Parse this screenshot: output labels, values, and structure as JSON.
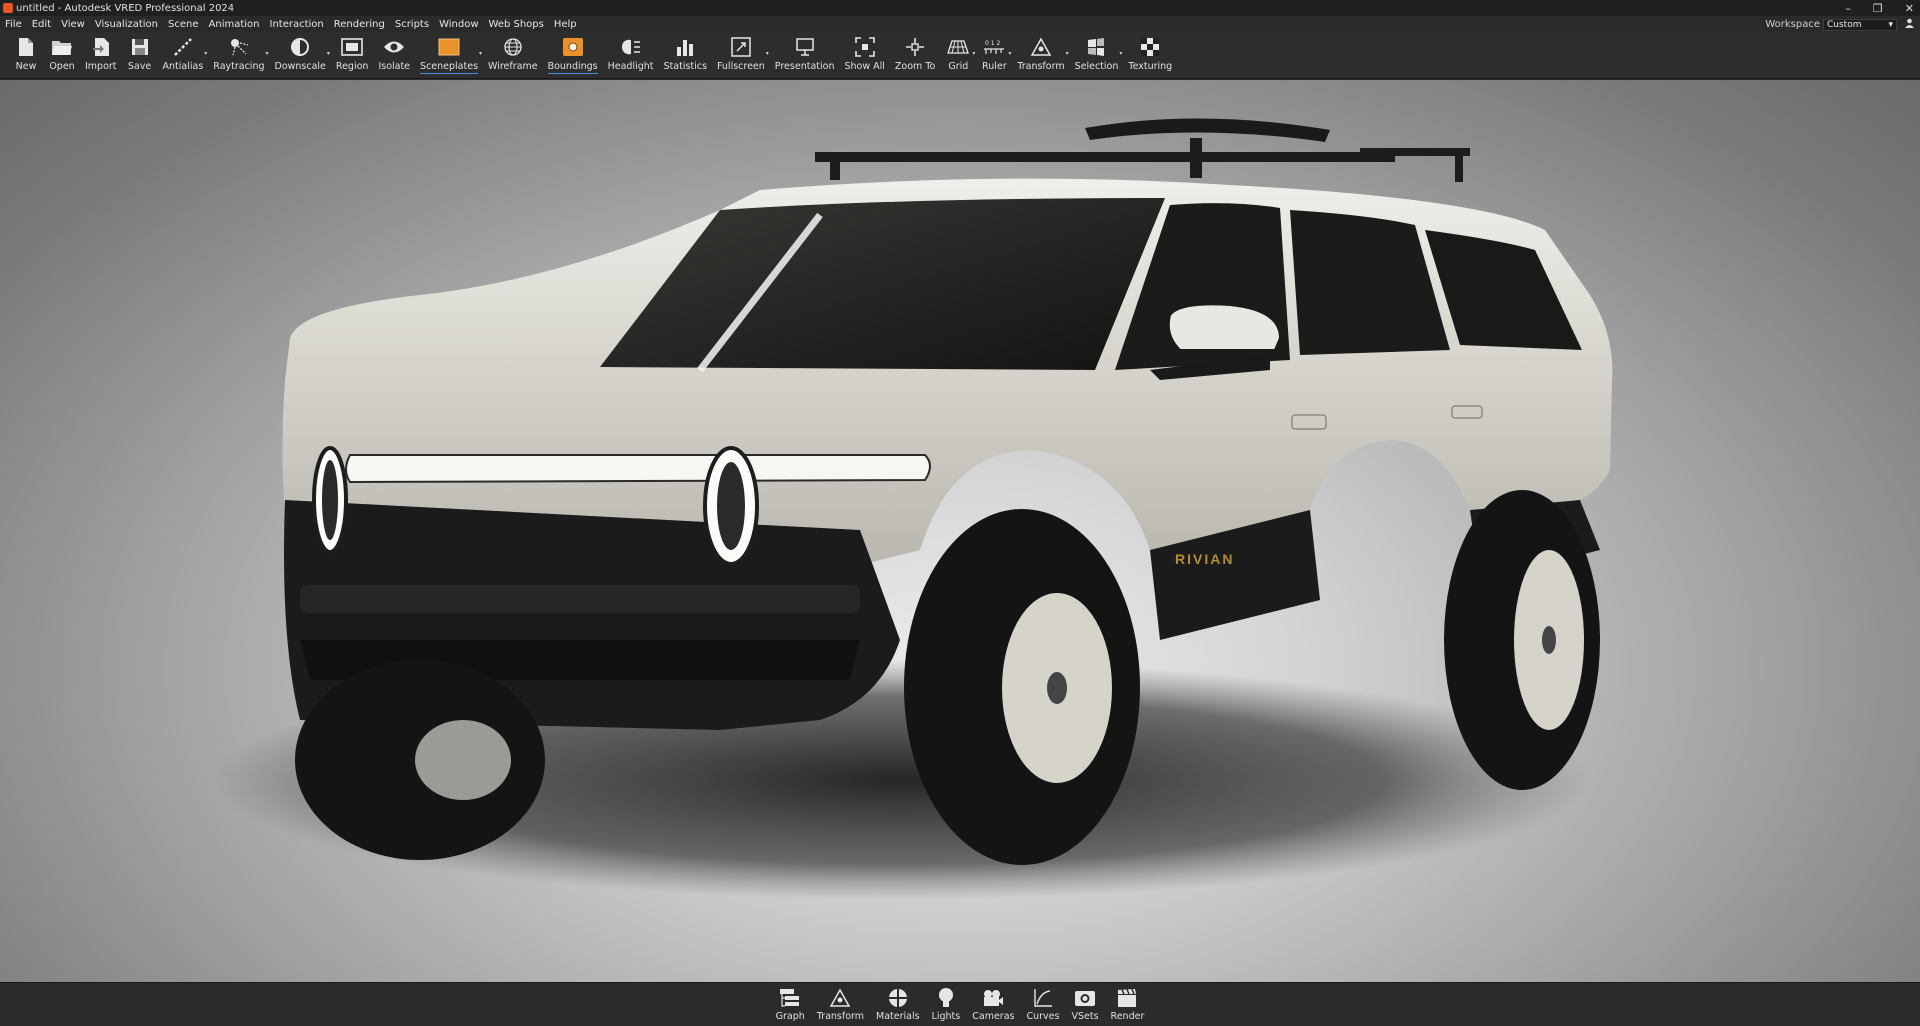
{
  "window": {
    "title": "untitled - Autodesk VRED Professional 2024",
    "controls": {
      "minimize": "–",
      "restore": "❐",
      "close": "✕"
    }
  },
  "menu": {
    "items": [
      "File",
      "Edit",
      "View",
      "Visualization",
      "Scene",
      "Animation",
      "Interaction",
      "Rendering",
      "Scripts",
      "Window",
      "Web Shops",
      "Help"
    ]
  },
  "workspace": {
    "label": "Workspace",
    "value": "Custom",
    "arrow": "▾"
  },
  "toolbar": {
    "buttons": [
      {
        "label": "New",
        "icon": "new-file-icon"
      },
      {
        "label": "Open",
        "icon": "open-folder-icon"
      },
      {
        "label": "Import",
        "icon": "import-icon"
      },
      {
        "label": "Save",
        "icon": "save-disk-icon"
      },
      {
        "label": "Antialias",
        "icon": "antialias-icon",
        "dropdown": true
      },
      {
        "label": "Raytracing",
        "icon": "raytracing-icon",
        "dropdown": true
      },
      {
        "label": "Downscale",
        "icon": "downscale-icon",
        "dropdown": true
      },
      {
        "label": "Region",
        "icon": "region-icon"
      },
      {
        "label": "Isolate",
        "icon": "isolate-eye-icon"
      },
      {
        "label": "Sceneplates",
        "icon": "sceneplates-icon",
        "dropdown": true,
        "active": true
      },
      {
        "label": "Wireframe",
        "icon": "wireframe-globe-icon"
      },
      {
        "label": "Boundings",
        "icon": "boundings-icon",
        "active": true
      },
      {
        "label": "Headlight",
        "icon": "headlight-icon"
      },
      {
        "label": "Statistics",
        "icon": "statistics-bar-icon"
      },
      {
        "label": "Fullscreen",
        "icon": "fullscreen-icon",
        "dropdown": true
      },
      {
        "label": "Presentation",
        "icon": "presentation-icon"
      },
      {
        "label": "Show All",
        "icon": "show-all-icon"
      },
      {
        "label": "Zoom To",
        "icon": "zoom-to-icon"
      },
      {
        "label": "Grid",
        "icon": "grid-icon",
        "dropdown": true
      },
      {
        "label": "Ruler",
        "icon": "ruler-icon",
        "dropdown": true
      },
      {
        "label": "Transform",
        "icon": "transform-icon",
        "dropdown": true
      },
      {
        "label": "Selection",
        "icon": "selection-icon",
        "dropdown": true
      },
      {
        "label": "Texturing",
        "icon": "texturing-checker-icon"
      }
    ]
  },
  "viewport": {
    "badge": "RIVIAN"
  },
  "bottom_bar": {
    "buttons": [
      {
        "label": "Graph",
        "icon": "graph-icon"
      },
      {
        "label": "Transform",
        "icon": "transform-icon"
      },
      {
        "label": "Materials",
        "icon": "materials-icon"
      },
      {
        "label": "Lights",
        "icon": "lights-bulb-icon"
      },
      {
        "label": "Cameras",
        "icon": "cameras-icon"
      },
      {
        "label": "Curves",
        "icon": "curves-icon"
      },
      {
        "label": "VSets",
        "icon": "vsets-icon"
      },
      {
        "label": "Render",
        "icon": "render-clapper-icon"
      }
    ]
  },
  "colors": {
    "accent_orange": "#e8922a",
    "active_underline": "#4a90e2",
    "vehicle_paint": "#d6d4cc"
  }
}
